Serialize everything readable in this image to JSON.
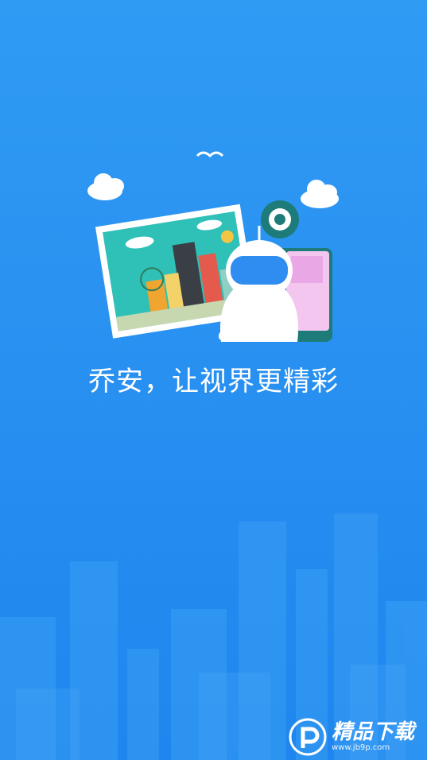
{
  "slogan": "乔安，让视界更精彩",
  "watermark": {
    "name": "精品下载",
    "url": "www.jb9p.com"
  },
  "colors": {
    "background": "#2a92f1",
    "robot_visor": "#2f8cf0",
    "photo_sky": "#2fc0b8"
  }
}
